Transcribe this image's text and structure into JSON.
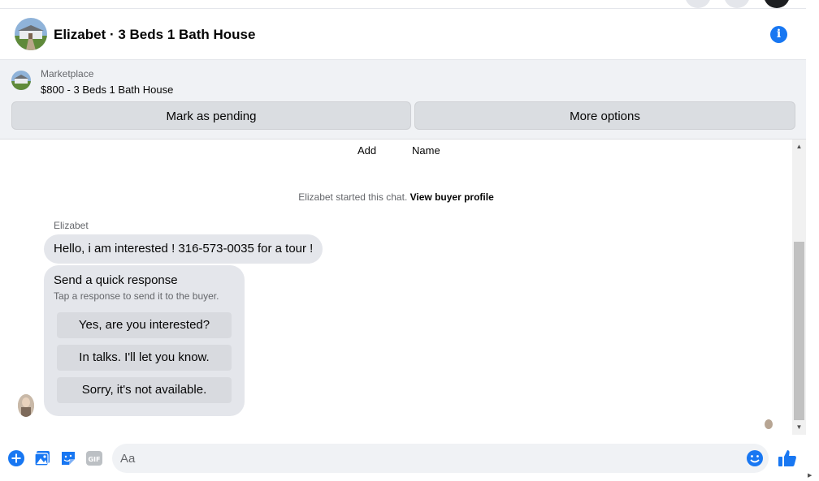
{
  "header": {
    "title": "Elizabet · 3 Beds 1 Bath House",
    "info_icon": "info-icon"
  },
  "marketplace": {
    "label": "Marketplace",
    "listing": "$800 - 3 Beds 1 Bath House",
    "mark_pending_label": "Mark as pending",
    "more_options_label": "More options"
  },
  "chat": {
    "add_label": "Add",
    "name_label": "Name",
    "started_text": "Elizabet started this chat.",
    "view_profile_link": "View buyer profile",
    "sender_name": "Elizabet",
    "message": "Hello, i am interested ! 316-573-0035 for a tour !",
    "quick_response": {
      "title": "Send a quick response",
      "subtitle": "Tap a response to send it to the buyer.",
      "options": [
        "Yes, are you interested?",
        "In talks. I'll let you know.",
        "Sorry, it's not available."
      ]
    }
  },
  "composer": {
    "placeholder": "Aa",
    "icons": [
      "plus-circle-icon",
      "photo-icon",
      "sticker-icon",
      "gif-icon",
      "emoji-icon",
      "thumbs-up-icon"
    ]
  },
  "colors": {
    "accent": "#1877f2",
    "bubble": "#e4e6eb",
    "panel": "#f0f2f5"
  }
}
